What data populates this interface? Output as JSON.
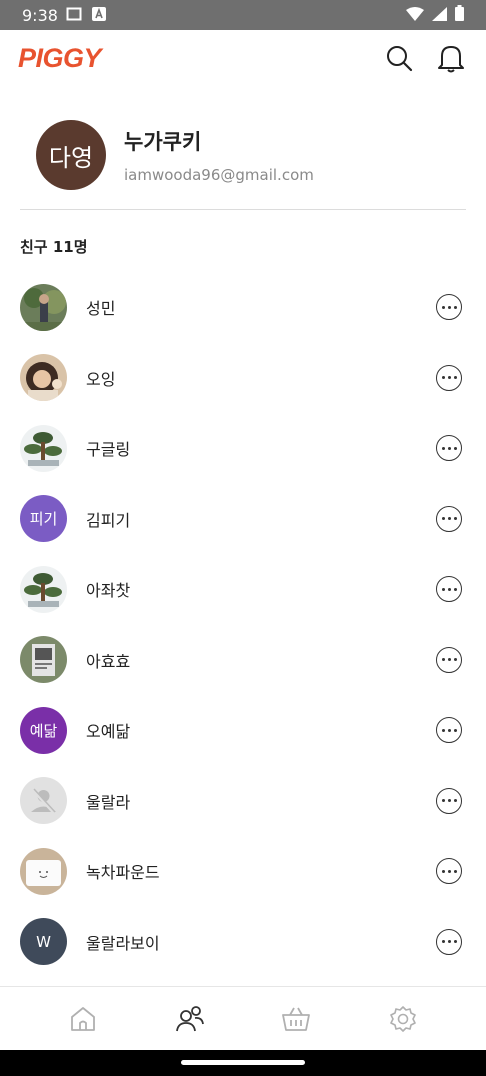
{
  "status_bar": {
    "time": "9:38",
    "left_icons": [
      "notification-square-icon",
      "a-badge-icon"
    ],
    "right_icons": [
      "wifi-icon",
      "signal-icon",
      "battery-icon"
    ]
  },
  "header": {
    "logo": "PIGGY",
    "brand_color": "#e8532f"
  },
  "profile": {
    "avatar_text": "다영",
    "avatar_color": "#5a3a2e",
    "name": "누가쿠키",
    "email": "iamwooda96@gmail.com"
  },
  "friends": {
    "count_label": "친구 11명",
    "items": [
      {
        "name": "성민",
        "avatar_type": "photo",
        "avatar_icon": "nature-photo-icon"
      },
      {
        "name": "오잉",
        "avatar_type": "photo",
        "avatar_icon": "person-photo-icon"
      },
      {
        "name": "구글링",
        "avatar_type": "photo",
        "avatar_icon": "bonsai-photo-icon"
      },
      {
        "name": "김피기",
        "avatar_type": "text",
        "avatar_text": "피기",
        "avatar_color": "#7b5cc4"
      },
      {
        "name": "아좌찻",
        "avatar_type": "photo",
        "avatar_icon": "bonsai-photo-icon"
      },
      {
        "name": "아효효",
        "avatar_type": "photo",
        "avatar_icon": "poster-photo-icon"
      },
      {
        "name": "오예닮",
        "avatar_type": "text",
        "avatar_text": "예닮",
        "avatar_color": "#7a2fa8"
      },
      {
        "name": "울랄라",
        "avatar_type": "placeholder",
        "avatar_icon": "no-person-icon"
      },
      {
        "name": "녹차파운드",
        "avatar_type": "photo",
        "avatar_icon": "cake-photo-icon"
      },
      {
        "name": "울랄라보이",
        "avatar_type": "text",
        "avatar_text": "W",
        "avatar_color": "#3f4a5a"
      }
    ]
  },
  "bottom_nav": {
    "items": [
      {
        "icon": "home-icon",
        "active": false
      },
      {
        "icon": "friends-icon",
        "active": true
      },
      {
        "icon": "basket-icon",
        "active": false
      },
      {
        "icon": "settings-icon",
        "active": false
      }
    ]
  }
}
